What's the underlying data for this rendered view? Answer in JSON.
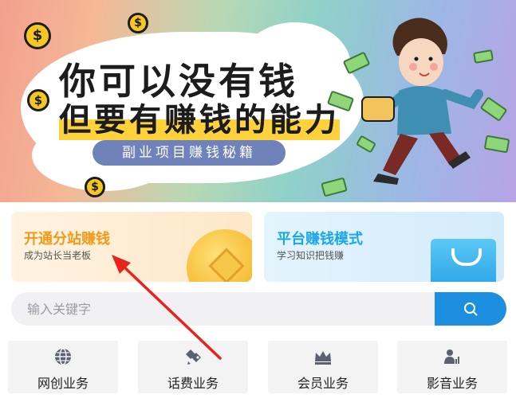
{
  "banner": {
    "headline1": "你可以没有钱",
    "headline2_a": "但要有",
    "headline2_b": "赚钱的能力",
    "pill": "副业项目赚钱秘籍",
    "coin_symbol": "$"
  },
  "cards": [
    {
      "title": "开通分站赚钱",
      "subtitle": "成为站长当老板"
    },
    {
      "title": "平台赚钱模式",
      "subtitle": "学习知识把钱赚"
    }
  ],
  "search": {
    "placeholder": "输入关键字",
    "icon": "search-icon"
  },
  "nav": [
    {
      "label": "网创业务",
      "icon": "globe-icon"
    },
    {
      "label": "话费业务",
      "icon": "phone-tag-icon"
    },
    {
      "label": "会员业务",
      "icon": "crown-icon"
    },
    {
      "label": "影音业务",
      "icon": "user-chart-icon"
    }
  ],
  "colors": {
    "accent": "#1d8fe0",
    "arrow": "#e8231d",
    "card_left_title": "#f39a1b",
    "card_right_title": "#1aa6ec"
  }
}
